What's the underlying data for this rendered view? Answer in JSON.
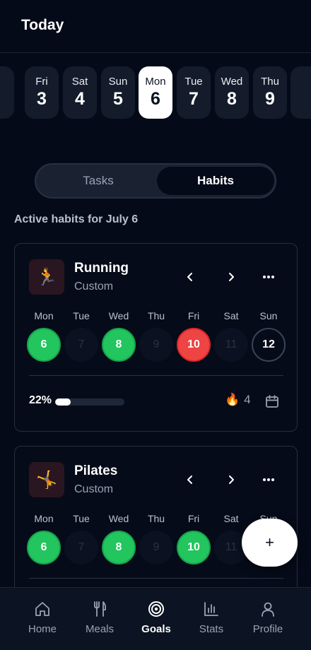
{
  "header": {
    "title": "Today"
  },
  "date_strip": [
    {
      "dow": "",
      "num": ""
    },
    {
      "dow": "Fri",
      "num": "3"
    },
    {
      "dow": "Sat",
      "num": "4"
    },
    {
      "dow": "Sun",
      "num": "5"
    },
    {
      "dow": "Mon",
      "num": "6",
      "selected": true
    },
    {
      "dow": "Tue",
      "num": "7"
    },
    {
      "dow": "Wed",
      "num": "8"
    },
    {
      "dow": "Thu",
      "num": "9"
    },
    {
      "dow": "",
      "num": ""
    }
  ],
  "segment": {
    "tasks_label": "Tasks",
    "habits_label": "Habits",
    "active": "Habits"
  },
  "section_title": "Active habits for July 6",
  "habits": [
    {
      "name": "Running",
      "type": "Custom",
      "icon": "runner-emoji",
      "icon_glyph": "🏃",
      "days": [
        {
          "label": "Mon",
          "num": "6",
          "status": "done"
        },
        {
          "label": "Tue",
          "num": "7",
          "status": "future"
        },
        {
          "label": "Wed",
          "num": "8",
          "status": "done"
        },
        {
          "label": "Thu",
          "num": "9",
          "status": "future"
        },
        {
          "label": "Fri",
          "num": "10",
          "status": "missed"
        },
        {
          "label": "Sat",
          "num": "11",
          "status": "future"
        },
        {
          "label": "Sun",
          "num": "12",
          "status": "today"
        }
      ],
      "progress_label": "22%",
      "progress": 0.22,
      "streak": "4"
    },
    {
      "name": "Pilates",
      "type": "Custom",
      "icon": "cartwheel-emoji",
      "icon_glyph": "🤸",
      "days": [
        {
          "label": "Mon",
          "num": "6",
          "status": "done"
        },
        {
          "label": "Tue",
          "num": "7",
          "status": "future"
        },
        {
          "label": "Wed",
          "num": "8",
          "status": "done"
        },
        {
          "label": "Thu",
          "num": "9",
          "status": "future"
        },
        {
          "label": "Fri",
          "num": "10",
          "status": "done"
        },
        {
          "label": "Sat",
          "num": "11",
          "status": "future"
        },
        {
          "label": "Sun",
          "num": "",
          "status": "hidden"
        }
      ]
    }
  ],
  "fab": {
    "label": "+"
  },
  "nav": [
    {
      "label": "Home",
      "icon": "home-icon"
    },
    {
      "label": "Meals",
      "icon": "fork-knife-icon"
    },
    {
      "label": "Goals",
      "icon": "target-icon",
      "active": true
    },
    {
      "label": "Stats",
      "icon": "bar-chart-icon"
    },
    {
      "label": "Profile",
      "icon": "person-icon"
    }
  ],
  "colors": {
    "background": "#050a18",
    "done": "#22c55e",
    "missed": "#ef4444",
    "accent": "#ffffff"
  }
}
